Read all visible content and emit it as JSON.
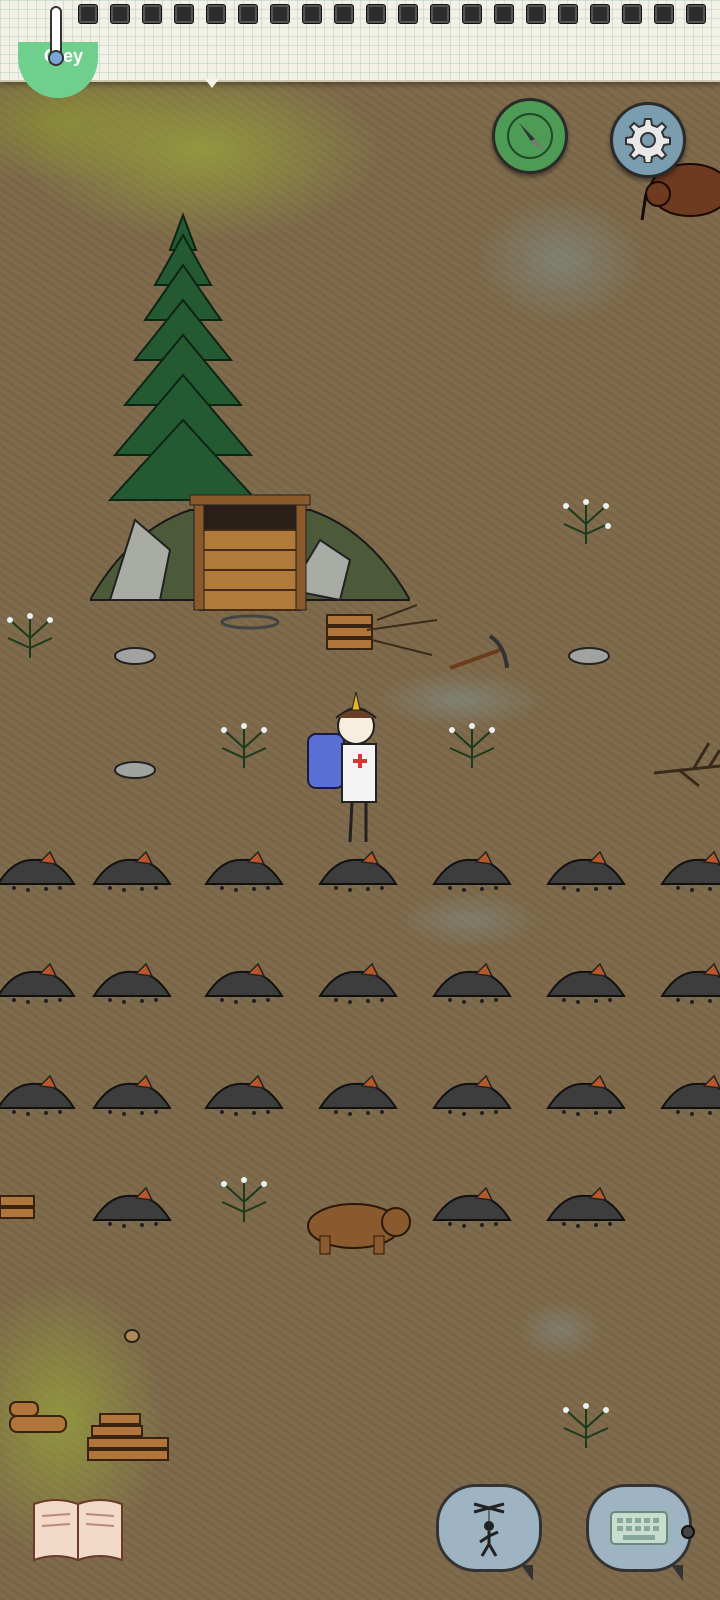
{
  "hud": {
    "temperature_label": "Oley",
    "inventory_slot_count": 20
  },
  "buttons": {
    "map_icon": "compass-icon",
    "settings_icon": "gear-icon",
    "book_icon": "open-book-icon",
    "emote_icon": "puppet-icon",
    "chat_icon": "keyboard-icon"
  },
  "colors": {
    "ground": "#7d6849",
    "grass": "#96a03c",
    "compass_green": "#4e9b55",
    "settings_blue": "#7b9db0"
  }
}
